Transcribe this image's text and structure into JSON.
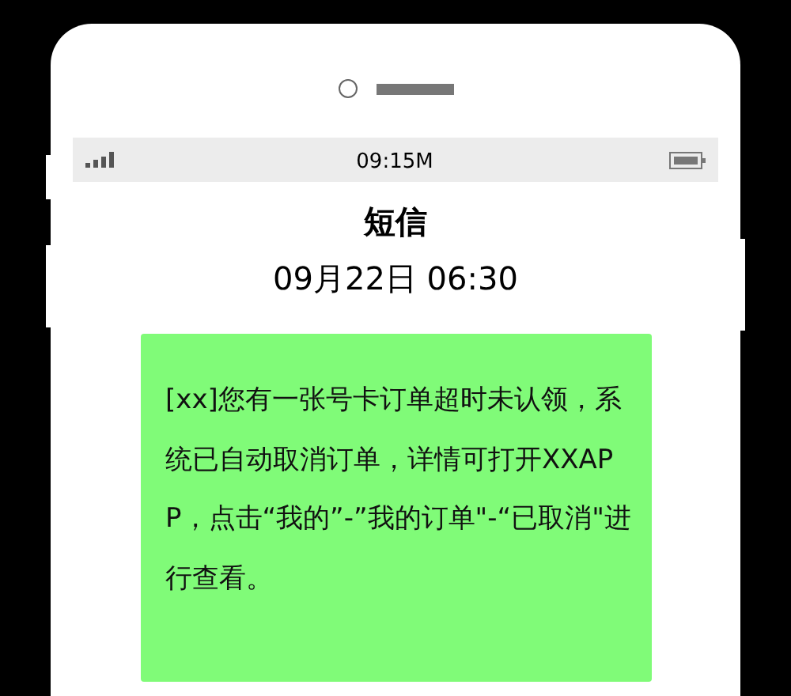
{
  "status_bar": {
    "time": "09:15M"
  },
  "title": "短信",
  "timestamp": "09月22日 06:30",
  "message": {
    "text": "[xx]您有一张号卡订单超时未认领，系统已自动取消订单，详情可打开XXAPP，点击“我的”-”我的订单\"-“已取消\"进行查看。"
  }
}
